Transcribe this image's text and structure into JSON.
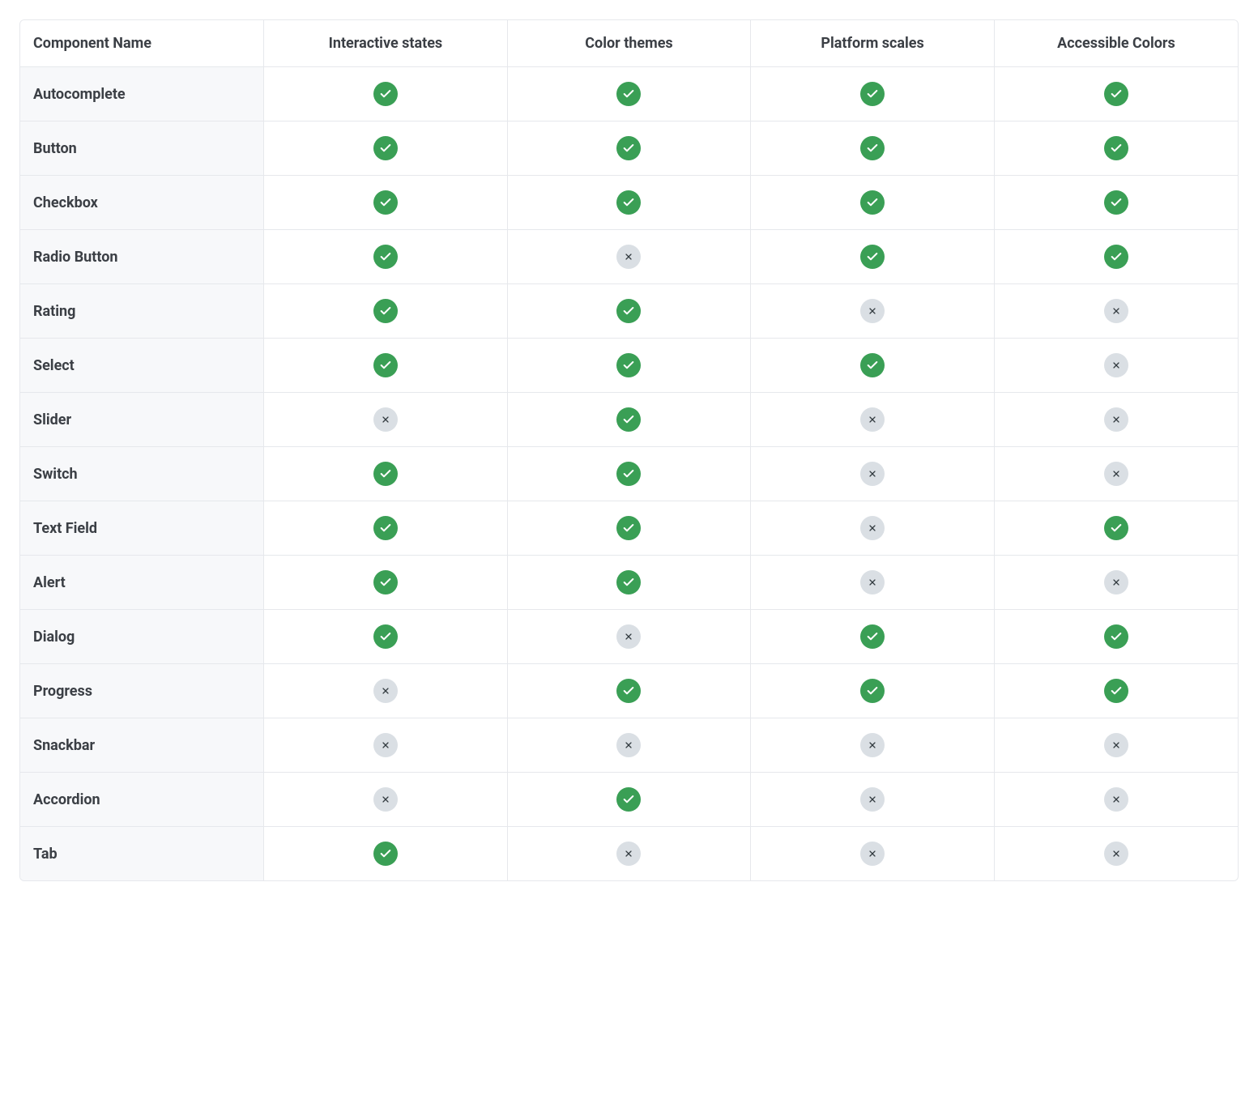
{
  "table": {
    "columns": [
      "Component Name",
      "Interactive states",
      "Color themes",
      "Platform scales",
      "Accessible Colors"
    ],
    "rows": [
      {
        "name": "Autocomplete",
        "interactive_states": true,
        "color_themes": true,
        "platform_scales": true,
        "accessible_colors": true
      },
      {
        "name": "Button",
        "interactive_states": true,
        "color_themes": true,
        "platform_scales": true,
        "accessible_colors": true
      },
      {
        "name": "Checkbox",
        "interactive_states": true,
        "color_themes": true,
        "platform_scales": true,
        "accessible_colors": true
      },
      {
        "name": "Radio Button",
        "interactive_states": true,
        "color_themes": false,
        "platform_scales": true,
        "accessible_colors": true
      },
      {
        "name": "Rating",
        "interactive_states": true,
        "color_themes": true,
        "platform_scales": false,
        "accessible_colors": false
      },
      {
        "name": "Select",
        "interactive_states": true,
        "color_themes": true,
        "platform_scales": true,
        "accessible_colors": false
      },
      {
        "name": "Slider",
        "interactive_states": false,
        "color_themes": true,
        "platform_scales": false,
        "accessible_colors": false
      },
      {
        "name": "Switch",
        "interactive_states": true,
        "color_themes": true,
        "platform_scales": false,
        "accessible_colors": false
      },
      {
        "name": "Text Field",
        "interactive_states": true,
        "color_themes": true,
        "platform_scales": false,
        "accessible_colors": true
      },
      {
        "name": "Alert",
        "interactive_states": true,
        "color_themes": true,
        "platform_scales": false,
        "accessible_colors": false
      },
      {
        "name": "Dialog",
        "interactive_states": true,
        "color_themes": false,
        "platform_scales": true,
        "accessible_colors": true
      },
      {
        "name": "Progress",
        "interactive_states": false,
        "color_themes": true,
        "platform_scales": true,
        "accessible_colors": true
      },
      {
        "name": "Snackbar",
        "interactive_states": false,
        "color_themes": false,
        "platform_scales": false,
        "accessible_colors": false
      },
      {
        "name": "Accordion",
        "interactive_states": false,
        "color_themes": true,
        "platform_scales": false,
        "accessible_colors": false
      },
      {
        "name": "Tab",
        "interactive_states": true,
        "color_themes": false,
        "platform_scales": false,
        "accessible_colors": false
      }
    ],
    "value_columns": [
      "interactive_states",
      "color_themes",
      "platform_scales",
      "accessible_colors"
    ]
  },
  "icons": {
    "check": "check-icon",
    "cross": "cross-icon"
  },
  "colors": {
    "success": "#3a9f55",
    "muted_bg": "#dadfe4",
    "text": "#3b3f45",
    "name_bg": "#f7f8fa",
    "border": "#e6e8ec"
  }
}
